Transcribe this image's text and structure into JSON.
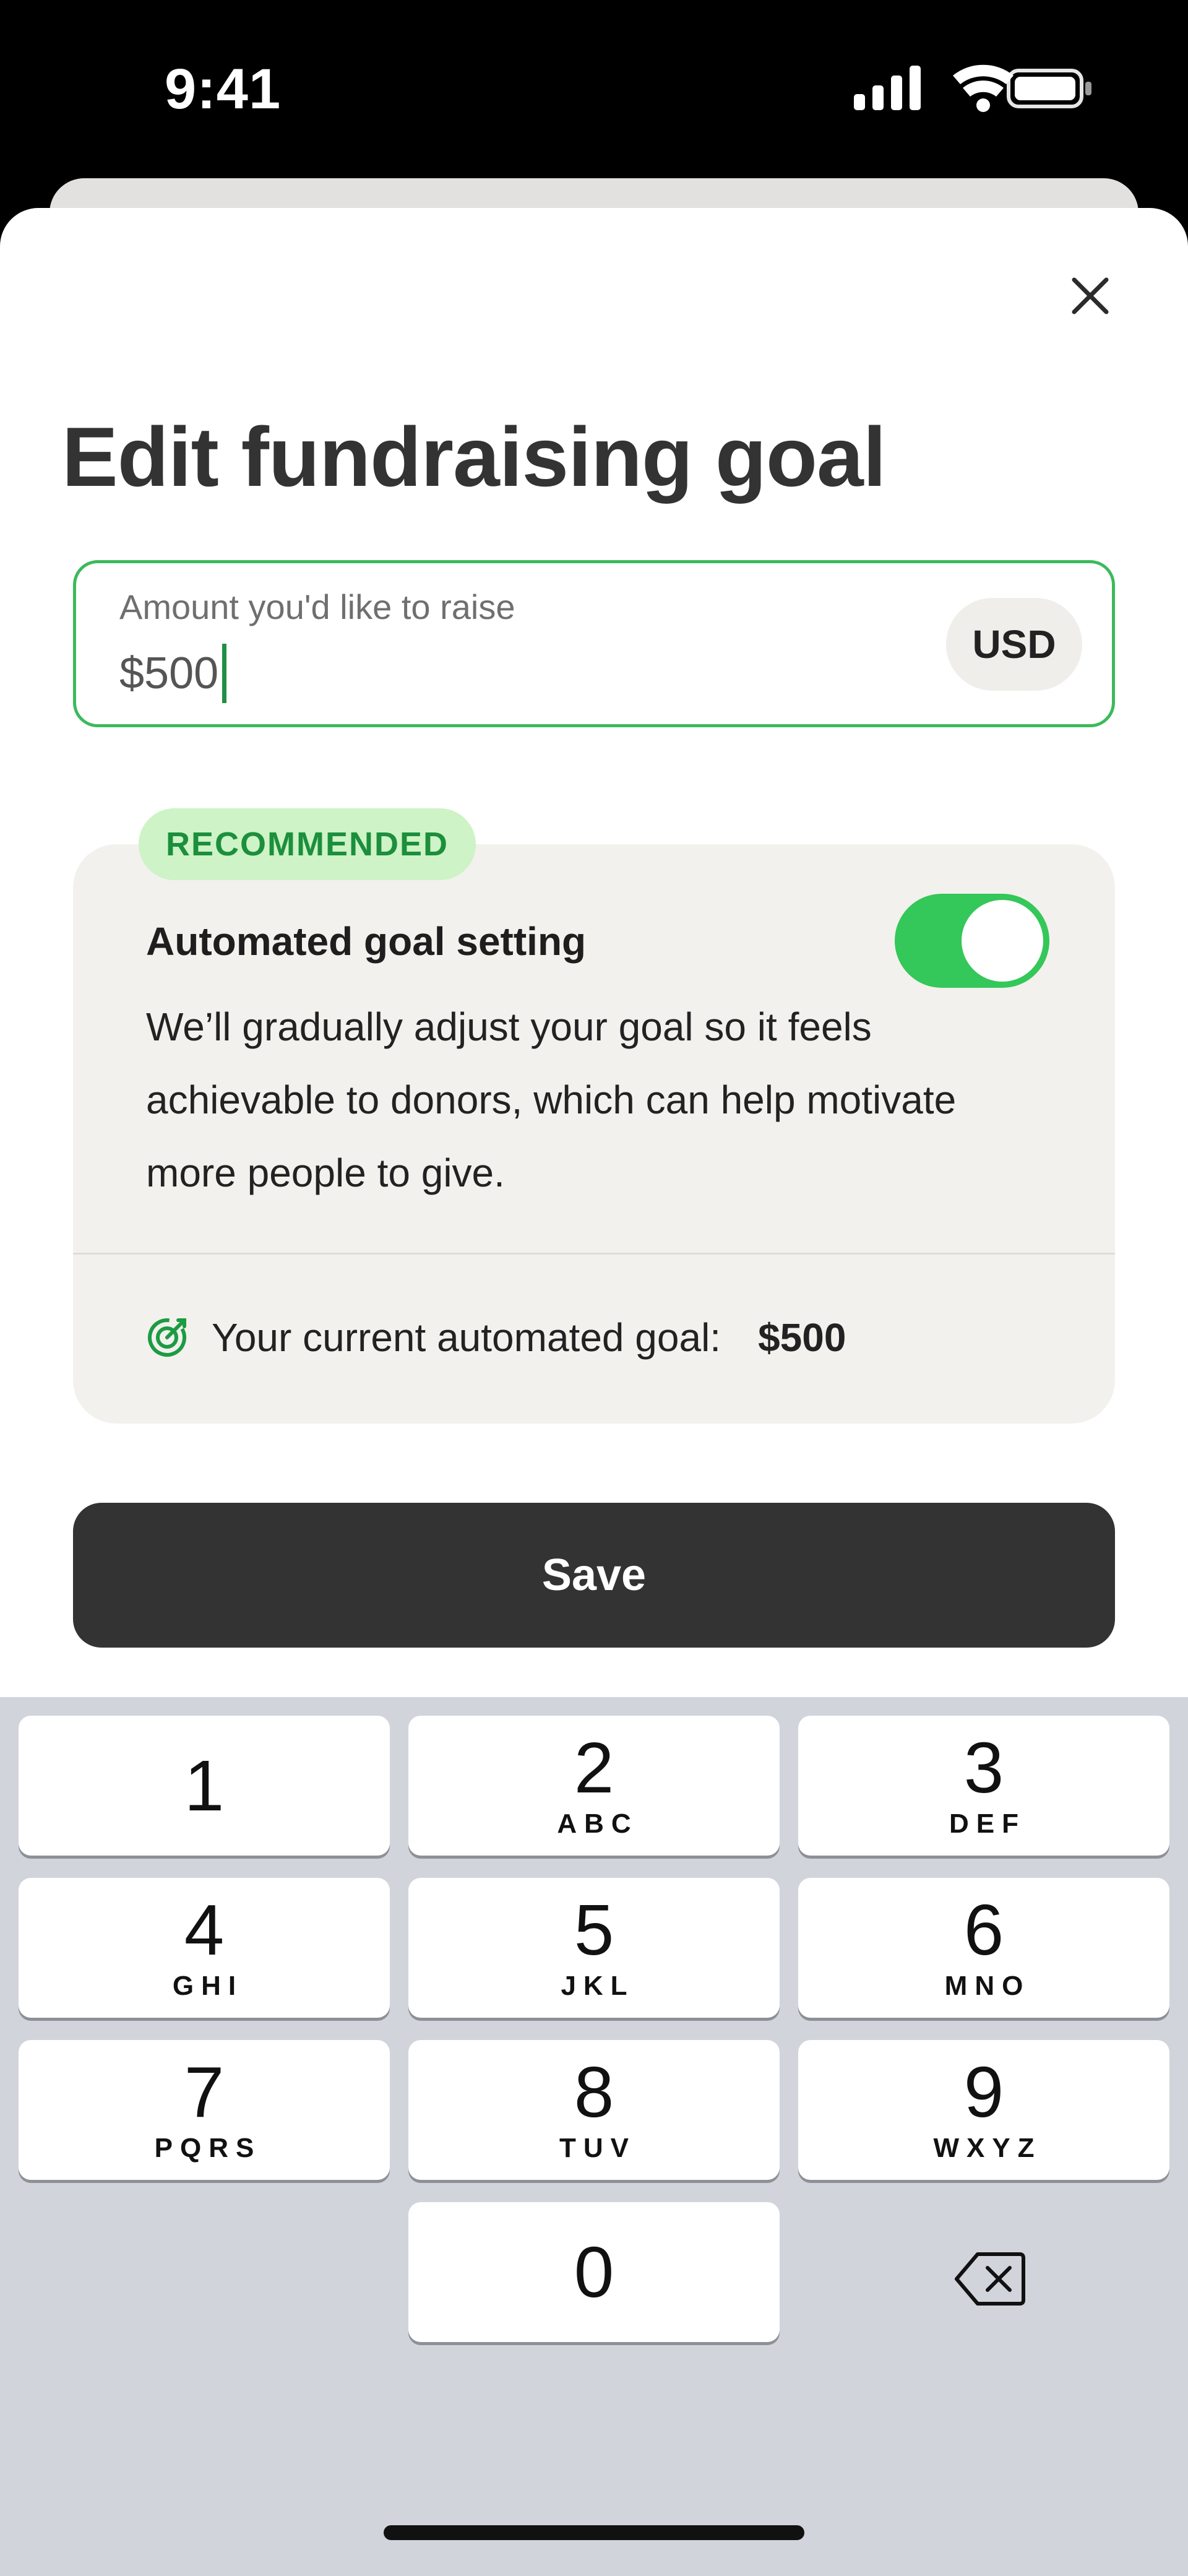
{
  "status_bar": {
    "time": "9:41",
    "icons": [
      "signal-icon",
      "wifi-icon",
      "battery-icon"
    ]
  },
  "modal": {
    "title": "Edit fundraising goal",
    "close_icon": "close-icon"
  },
  "amount_field": {
    "label": "Amount you'd like to raise",
    "value": "$500",
    "currency": "USD"
  },
  "automated_goal": {
    "badge": "RECOMMENDED",
    "heading": "Automated goal setting",
    "toggle_on": true,
    "description": "We’ll gradually adjust your goal so it feels achievable to donors, which can help motivate more people to give.",
    "current_label": "Your current automated goal:",
    "current_value": "$500",
    "icon": "target-icon"
  },
  "save_button": {
    "label": "Save"
  },
  "keyboard": {
    "keys": [
      {
        "digit": "1",
        "letters": ""
      },
      {
        "digit": "2",
        "letters": "ABC"
      },
      {
        "digit": "3",
        "letters": "DEF"
      },
      {
        "digit": "4",
        "letters": "GHI"
      },
      {
        "digit": "5",
        "letters": "JKL"
      },
      {
        "digit": "6",
        "letters": "MNO"
      },
      {
        "digit": "7",
        "letters": "PQRS"
      },
      {
        "digit": "8",
        "letters": "TUV"
      },
      {
        "digit": "9",
        "letters": "WXYZ"
      },
      {
        "digit": "0",
        "letters": ""
      }
    ],
    "delete_icon": "backspace-icon"
  },
  "colors": {
    "accent_green": "#34c759",
    "badge_bg": "#cdf3c6",
    "badge_text": "#1c8f3c",
    "button_dark": "#333333",
    "card_bg": "#f2f1ed",
    "keyboard_bg": "#d1d4db"
  }
}
